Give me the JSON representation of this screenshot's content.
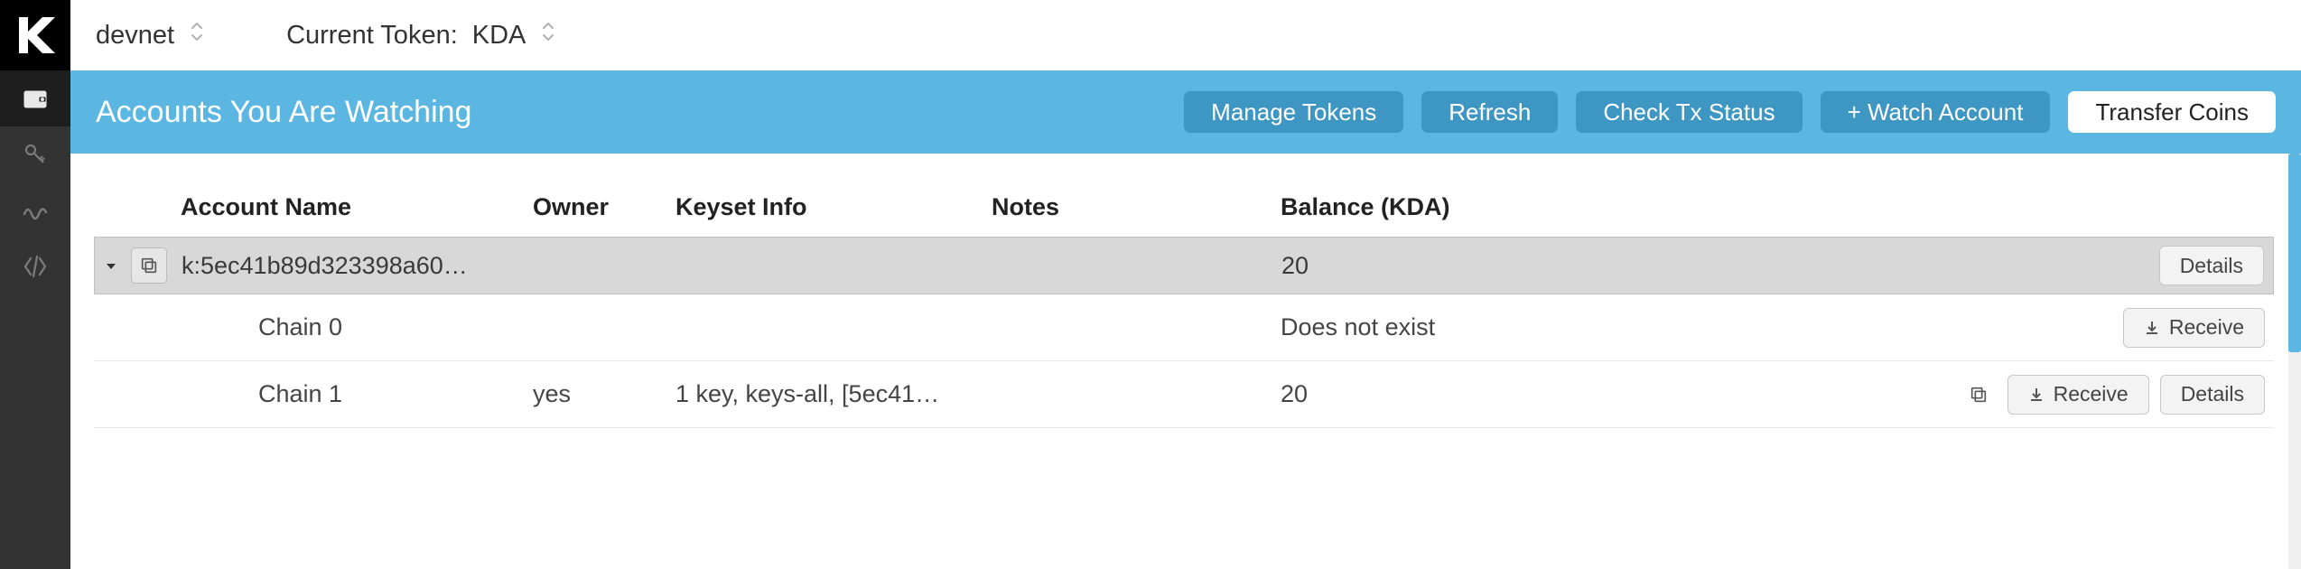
{
  "topbar": {
    "network_value": "devnet",
    "token_label": "Current Token:",
    "token_value": "KDA"
  },
  "banner": {
    "title": "Accounts You Are Watching",
    "buttons": {
      "manage_tokens": "Manage Tokens",
      "refresh": "Refresh",
      "check_tx": "Check Tx Status",
      "watch_account": "+ Watch Account",
      "transfer": "Transfer Coins"
    }
  },
  "table": {
    "headers": {
      "account": "Account Name",
      "owner": "Owner",
      "keyset": "Keyset Info",
      "notes": "Notes",
      "balance": "Balance (KDA)"
    },
    "summary": {
      "account": "k:5ec41b89d323398a60…",
      "balance": "20",
      "details_label": "Details"
    },
    "rows": [
      {
        "chain": "Chain 0",
        "owner": "",
        "keyset": "",
        "notes": "",
        "balance": "Does not exist",
        "receive_label": "Receive"
      },
      {
        "chain": "Chain 1",
        "owner": "yes",
        "keyset": "1 key, keys-all, [5ec41…",
        "notes": "",
        "balance": "20",
        "receive_label": "Receive",
        "details_label": "Details"
      }
    ]
  }
}
